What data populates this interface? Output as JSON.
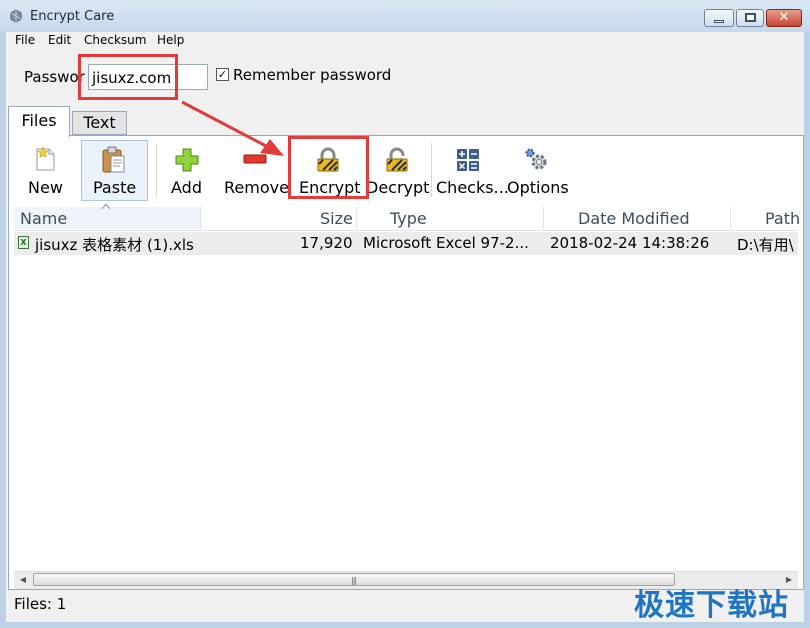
{
  "window": {
    "title": "Encrypt Care"
  },
  "menu": [
    "File",
    "Edit",
    "Checksum",
    "Help"
  ],
  "password": {
    "label": "Passwor",
    "value": "jisuxz.com",
    "remember_label": "Remember password",
    "remember_checked": true
  },
  "tabs": [
    "Files",
    "Text"
  ],
  "toolbar": {
    "new": "New",
    "paste": "Paste",
    "add": "Add",
    "remove": "Remove",
    "encrypt": "Encrypt",
    "decrypt": "Decrypt",
    "checksum": "Checks...",
    "options": "Options"
  },
  "table": {
    "columns": [
      "Name",
      "Size",
      "Type",
      "Date Modified",
      "Path"
    ],
    "rows": [
      {
        "name": "jisuxz 表格素材 (1).xls",
        "size": "17,920",
        "type": "Microsoft Excel 97-2...",
        "date": "2018-02-24 14:38:26",
        "path": "D:\\有用\\"
      }
    ]
  },
  "status": {
    "text": "Files: 1"
  },
  "watermark": "极速下载站",
  "colors": {
    "accent": "#e33a3a",
    "watermark": "#1f74c6",
    "titlebar": "#c6d8ec"
  }
}
